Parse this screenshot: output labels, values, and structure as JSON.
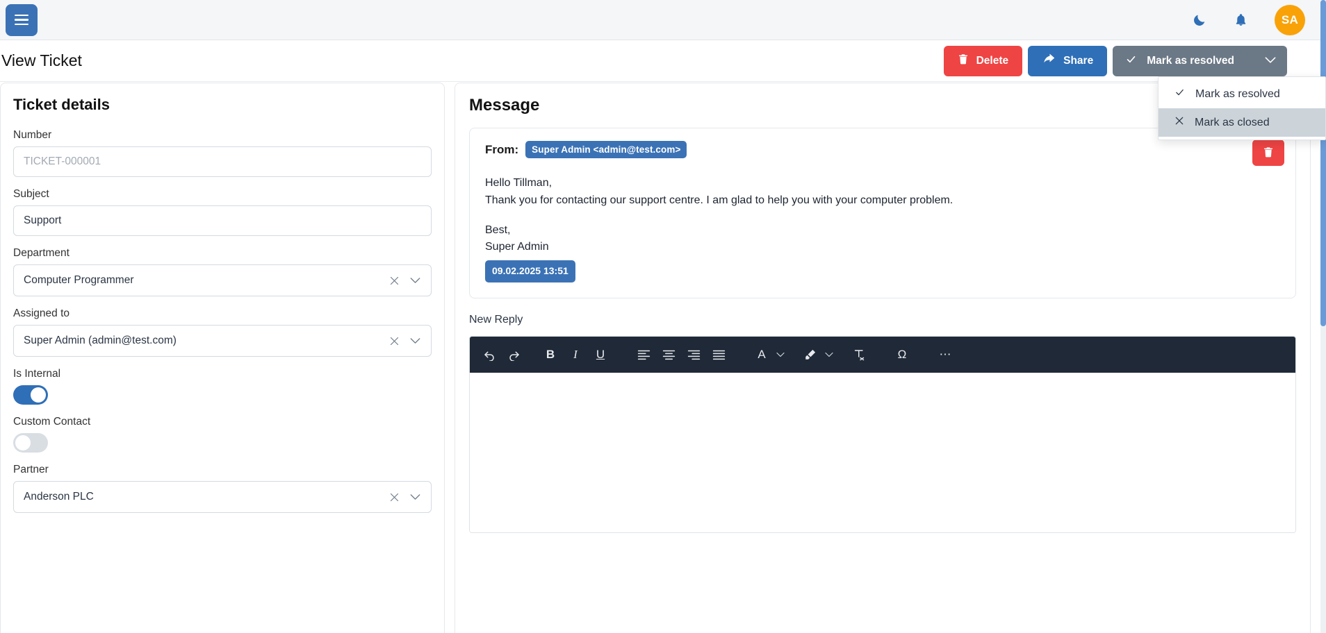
{
  "navbar": {
    "menu_icon": "hamburger-icon",
    "theme_icon": "moon-icon",
    "notifications_icon": "bell-icon",
    "avatar_initials": "SA"
  },
  "header": {
    "title": "View Ticket",
    "buttons": {
      "delete": "Delete",
      "share": "Share",
      "resolve": "Mark as resolved"
    }
  },
  "dropdown": {
    "items": [
      {
        "label": "Mark as resolved",
        "icon": "check-icon",
        "hovered": false
      },
      {
        "label": "Mark as closed",
        "icon": "close-icon",
        "hovered": true
      }
    ]
  },
  "ticket_details": {
    "title": "Ticket details",
    "fields": {
      "number": {
        "label": "Number",
        "placeholder": "TICKET-000001",
        "value": ""
      },
      "subject": {
        "label": "Subject",
        "value": "Support"
      },
      "department": {
        "label": "Department",
        "value": "Computer Programmer"
      },
      "assigned_to": {
        "label": "Assigned to",
        "value": "Super Admin (admin@test.com)"
      },
      "is_internal": {
        "label": "Is Internal",
        "state": "on"
      },
      "custom_contact": {
        "label": "Custom Contact",
        "state": "off"
      },
      "partner": {
        "label": "Partner",
        "value": "Anderson PLC"
      }
    }
  },
  "message_panel": {
    "title": "Message",
    "from_label": "From:",
    "from_value": "Super Admin <admin@test.com>",
    "body_line_1": "Hello Tillman,",
    "body_line_2": "Thank you for contacting our support centre. I am glad to help you with your computer problem.",
    "body_line_3": "Best,",
    "body_line_4": "Super Admin",
    "timestamp": "09.02.2025 13:51",
    "delete_icon": "trash-icon"
  },
  "reply_editor": {
    "label": "New Reply",
    "toolbar": [
      {
        "name": "undo-icon",
        "glyph": "↶"
      },
      {
        "name": "redo-icon",
        "glyph": "↷"
      },
      {
        "name": "bold-icon",
        "glyph": "B"
      },
      {
        "name": "italic-icon",
        "glyph": "I"
      },
      {
        "name": "underline-icon",
        "glyph": "U"
      },
      {
        "name": "align-left-icon",
        "glyph": "≡"
      },
      {
        "name": "align-center-icon",
        "glyph": "≡"
      },
      {
        "name": "align-right-icon",
        "glyph": "≡"
      },
      {
        "name": "align-justify-icon",
        "glyph": "≡"
      },
      {
        "name": "text-color-icon",
        "glyph": "A"
      },
      {
        "name": "highlight-color-icon",
        "glyph": "✎"
      },
      {
        "name": "clear-format-icon",
        "glyph": "T"
      },
      {
        "name": "special-char-icon",
        "glyph": "Ω"
      },
      {
        "name": "more-options-icon",
        "glyph": "⋯"
      }
    ],
    "content": ""
  },
  "colors": {
    "primary": "#2f6fb7",
    "danger": "#ef4444",
    "secondary": "#6b7886",
    "avatar": "#f9a208",
    "toolbar_bg": "#1f2937"
  }
}
